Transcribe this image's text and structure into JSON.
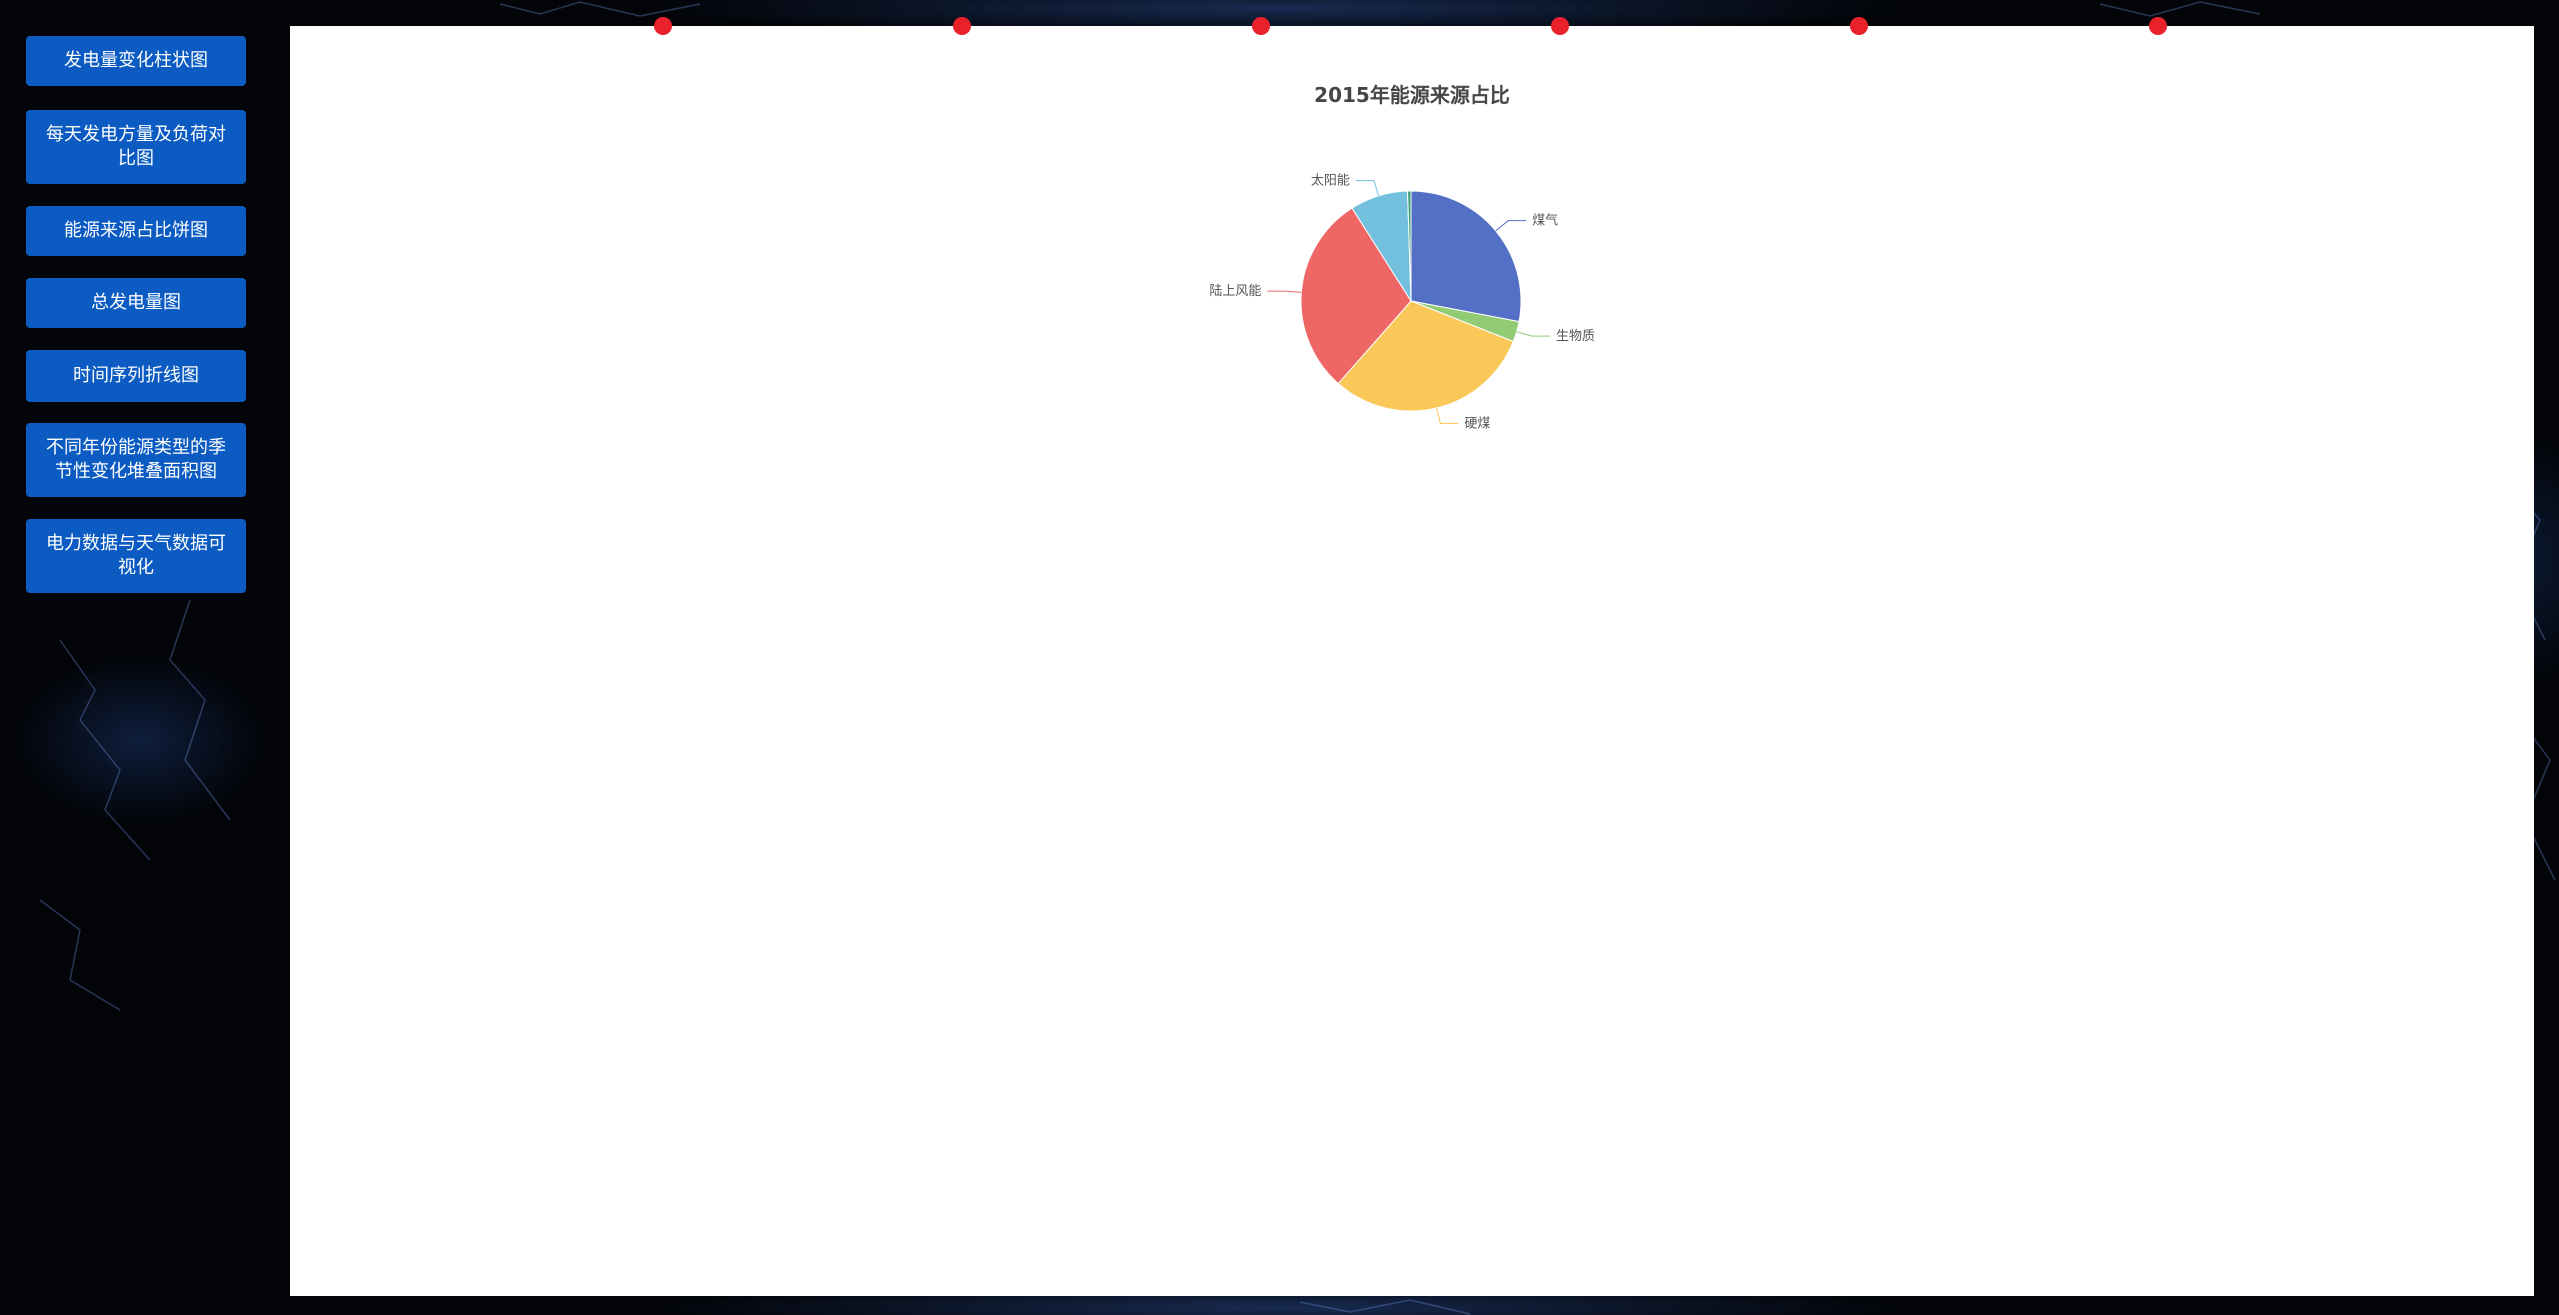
{
  "sidebar": {
    "items": [
      {
        "label": "发电量变化柱状图"
      },
      {
        "label": "每天发电方量及负荷对比图"
      },
      {
        "label": "能源来源占比饼图"
      },
      {
        "label": "总发电量图"
      },
      {
        "label": "时间序列折线图"
      },
      {
        "label": "不同年份能源类型的季节性变化堆叠面积图"
      },
      {
        "label": "电力数据与天气数据可视化"
      }
    ]
  },
  "colors": {
    "nav_button": "#0b5bc2",
    "panel": "#ffffff",
    "dots": "#e8212b"
  },
  "chart_data": {
    "type": "pie",
    "title": "2015年能源来源占比",
    "slices": [
      {
        "name": "煤气",
        "value": 28.0,
        "color": "#5470c6"
      },
      {
        "name": "生物质",
        "value": 3.0,
        "color": "#91cc75"
      },
      {
        "name": "硬煤",
        "value": 30.5,
        "color": "#fac858"
      },
      {
        "name": "陆上风能",
        "value": 29.5,
        "color": "#ee6666"
      },
      {
        "name": "太阳能",
        "value": 8.5,
        "color": "#73c0de"
      },
      {
        "name": "",
        "value": 0.5,
        "color": "#3ba272"
      }
    ],
    "start_angle_deg": 90,
    "clockwise": true
  }
}
